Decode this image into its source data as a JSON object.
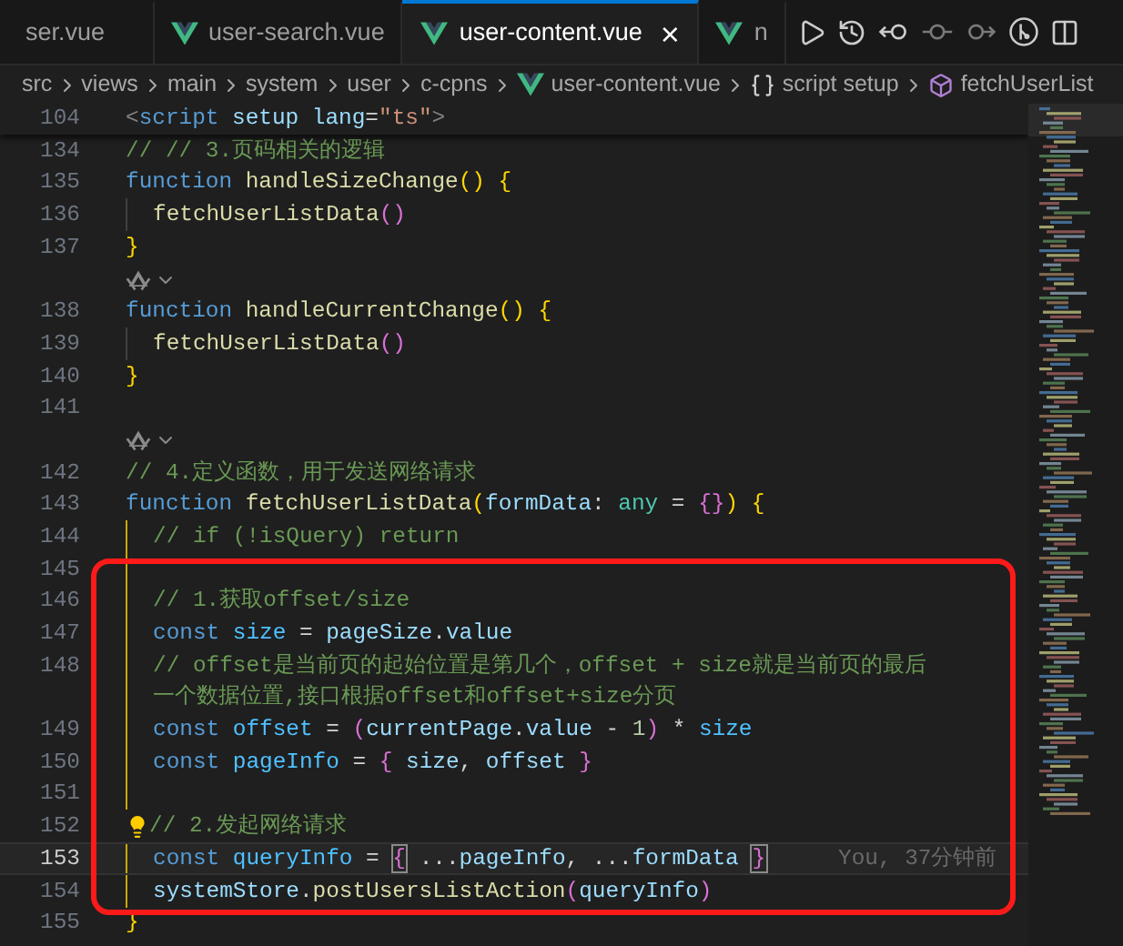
{
  "tabs": [
    {
      "label": "ser.vue",
      "selected": false,
      "clipped": true
    },
    {
      "label": "user-search.vue",
      "selected": false,
      "clipped": false
    },
    {
      "label": "user-content.vue",
      "selected": true,
      "clipped": false,
      "close": "×"
    },
    {
      "label": "n",
      "selected": false,
      "clipped": false
    }
  ],
  "breadcrumb": [
    {
      "kind": "folder",
      "label": "src"
    },
    {
      "kind": "folder",
      "label": "views"
    },
    {
      "kind": "folder",
      "label": "main"
    },
    {
      "kind": "folder",
      "label": "system"
    },
    {
      "kind": "folder",
      "label": "user"
    },
    {
      "kind": "folder",
      "label": "c-cpns"
    },
    {
      "kind": "vue",
      "label": "user-content.vue"
    },
    {
      "kind": "braces",
      "label": "script setup"
    },
    {
      "kind": "method",
      "label": "fetchUserList"
    }
  ],
  "sticky_line": {
    "number": "104",
    "tokens": [
      {
        "kind": "tag",
        "t": "<"
      },
      {
        "kind": "keyword",
        "t": "script "
      },
      {
        "kind": "variable",
        "t": "setup lang"
      },
      {
        "kind": "plain",
        "t": "="
      },
      {
        "kind": "string",
        "t": "\"ts\""
      },
      {
        "kind": "tag",
        "t": ">"
      }
    ]
  },
  "lines": [
    {
      "kind": "code",
      "number": "134",
      "tokens": [
        {
          "kind": "comment",
          "t": "// // 3.页码相关的逻辑"
        }
      ]
    },
    {
      "kind": "code",
      "number": "135",
      "tokens": [
        {
          "kind": "keyword",
          "t": "function "
        },
        {
          "kind": "function",
          "t": "handleSizeChange"
        },
        {
          "kind": "bracket1",
          "t": "() {"
        }
      ]
    },
    {
      "kind": "code",
      "number": "136",
      "indented": true,
      "active_scope": false,
      "tokens": [
        {
          "kind": "function",
          "t": "fetchUserListData"
        },
        {
          "kind": "bracket2",
          "t": "()"
        }
      ]
    },
    {
      "kind": "code",
      "number": "137",
      "tokens": [
        {
          "kind": "bracket1",
          "t": "}"
        }
      ]
    },
    {
      "kind": "lens"
    },
    {
      "kind": "code",
      "number": "138",
      "tokens": [
        {
          "kind": "keyword",
          "t": "function "
        },
        {
          "kind": "function",
          "t": "handleCurrentChange"
        },
        {
          "kind": "bracket1",
          "t": "() {"
        }
      ]
    },
    {
      "kind": "code",
      "number": "139",
      "indented": true,
      "active_scope": false,
      "tokens": [
        {
          "kind": "function",
          "t": "fetchUserListData"
        },
        {
          "kind": "bracket2",
          "t": "()"
        }
      ]
    },
    {
      "kind": "code",
      "number": "140",
      "tokens": [
        {
          "kind": "bracket1",
          "t": "}"
        }
      ]
    },
    {
      "kind": "code",
      "number": "141"
    },
    {
      "kind": "lens"
    },
    {
      "kind": "code",
      "number": "142",
      "tokens": [
        {
          "kind": "comment",
          "t": "// 4.定义函数，用于发送网络请求"
        }
      ]
    },
    {
      "kind": "code",
      "number": "143",
      "tokens": [
        {
          "kind": "keyword",
          "t": "function "
        },
        {
          "kind": "function",
          "t": "fetchUserListData"
        },
        {
          "kind": "bracket1",
          "t": "("
        },
        {
          "kind": "variable",
          "t": "formData"
        },
        {
          "kind": "plain",
          "t": ": "
        },
        {
          "kind": "type",
          "t": "any"
        },
        {
          "kind": "plain",
          "t": " = "
        },
        {
          "kind": "bracket2",
          "t": "{}"
        },
        {
          "kind": "bracket1",
          "t": ") {"
        }
      ]
    },
    {
      "kind": "code",
      "number": "144",
      "indented": true,
      "active_scope": true,
      "tokens": [
        {
          "kind": "comment",
          "t": "// if (!isQuery) return"
        }
      ]
    },
    {
      "kind": "code",
      "number": "145",
      "indented": true,
      "active_scope": true
    },
    {
      "kind": "code",
      "number": "146",
      "indented": true,
      "active_scope": true,
      "tokens": [
        {
          "kind": "comment",
          "t": "// 1.获取offset/size"
        }
      ]
    },
    {
      "kind": "code",
      "number": "147",
      "indented": true,
      "active_scope": true,
      "tokens": [
        {
          "kind": "keyword",
          "t": "const "
        },
        {
          "kind": "constant",
          "t": "size"
        },
        {
          "kind": "plain",
          "t": " = "
        },
        {
          "kind": "variable",
          "t": "pageSize"
        },
        {
          "kind": "plain",
          "t": "."
        },
        {
          "kind": "variable",
          "t": "value"
        }
      ]
    },
    {
      "kind": "code",
      "number": "148",
      "indented": true,
      "active_scope": true,
      "tokens": [
        {
          "kind": "comment",
          "t": "// offset是当前页的起始位置是第几个，offset + size就是当前页的最后"
        }
      ]
    },
    {
      "kind": "wrap",
      "indented": true,
      "active_scope": true,
      "tokens": [
        {
          "kind": "comment",
          "t": "一个数据位置,接口根据offset和offset+size分页"
        }
      ]
    },
    {
      "kind": "code",
      "number": "149",
      "indented": true,
      "active_scope": true,
      "tokens": [
        {
          "kind": "keyword",
          "t": "const "
        },
        {
          "kind": "constant",
          "t": "offset"
        },
        {
          "kind": "plain",
          "t": " = "
        },
        {
          "kind": "bracket2",
          "t": "("
        },
        {
          "kind": "variable",
          "t": "currentPage"
        },
        {
          "kind": "plain",
          "t": "."
        },
        {
          "kind": "variable",
          "t": "value"
        },
        {
          "kind": "plain",
          "t": " - "
        },
        {
          "kind": "number",
          "t": "1"
        },
        {
          "kind": "bracket2",
          "t": ")"
        },
        {
          "kind": "plain",
          "t": " * "
        },
        {
          "kind": "constant",
          "t": "size"
        }
      ]
    },
    {
      "kind": "code",
      "number": "150",
      "indented": true,
      "active_scope": true,
      "tokens": [
        {
          "kind": "keyword",
          "t": "const "
        },
        {
          "kind": "constant",
          "t": "pageInfo"
        },
        {
          "kind": "plain",
          "t": " = "
        },
        {
          "kind": "bracket2",
          "t": "{ "
        },
        {
          "kind": "variable",
          "t": "size"
        },
        {
          "kind": "plain",
          "t": ", "
        },
        {
          "kind": "variable",
          "t": "offset"
        },
        {
          "kind": "bracket2",
          "t": " }"
        }
      ]
    },
    {
      "kind": "code",
      "number": "151",
      "indented": true,
      "active_scope": true
    },
    {
      "kind": "code",
      "number": "152",
      "lightbulb": true,
      "tokens": [
        {
          "kind": "comment",
          "t": "// 2.发起网络请求"
        }
      ]
    },
    {
      "kind": "code",
      "number": "153",
      "indented": true,
      "active_scope": true,
      "current": true,
      "blame": "You, 37分钟前",
      "tokens": [
        {
          "kind": "keyword",
          "t": "const "
        },
        {
          "kind": "constant",
          "t": "queryInfo"
        },
        {
          "kind": "plain",
          "t": " = "
        },
        {
          "kind": "bracket2",
          "t": "{",
          "matched": true
        },
        {
          "kind": "plain",
          "t": " ..."
        },
        {
          "kind": "variable",
          "t": "pageInfo"
        },
        {
          "kind": "plain",
          "t": ", ..."
        },
        {
          "kind": "variable",
          "t": "formData "
        },
        {
          "kind": "bracket2",
          "t": "}",
          "matched": true
        }
      ]
    },
    {
      "kind": "code",
      "number": "154",
      "indented": true,
      "active_scope": true,
      "tokens": [
        {
          "kind": "variable",
          "t": "systemStore"
        },
        {
          "kind": "plain",
          "t": "."
        },
        {
          "kind": "function",
          "t": "postUsersListAction"
        },
        {
          "kind": "bracket2",
          "t": "("
        },
        {
          "kind": "variable",
          "t": "queryInfo"
        },
        {
          "kind": "bracket2",
          "t": ")"
        }
      ]
    },
    {
      "kind": "code",
      "number": "155",
      "tokens": [
        {
          "kind": "bracket1",
          "t": "}"
        }
      ]
    }
  ]
}
